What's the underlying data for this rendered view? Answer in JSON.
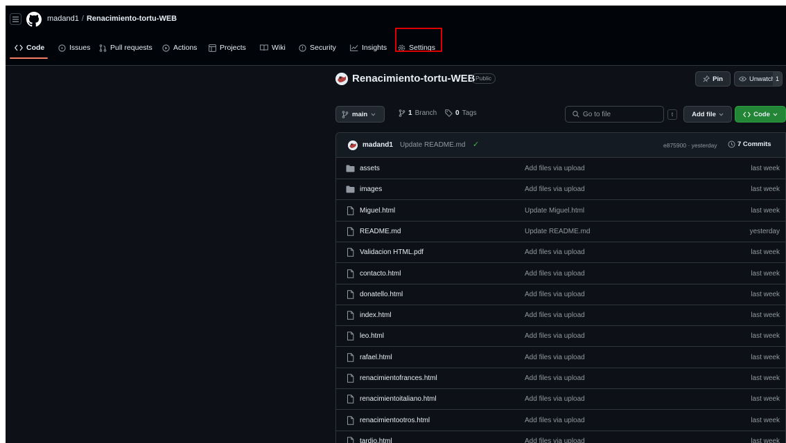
{
  "breadcrumb": {
    "owner": "madand1",
    "separator": "/",
    "repo": "Renacimiento-tortu-WEB"
  },
  "nav": {
    "tabs": [
      {
        "label": "Code",
        "icon": "code-icon"
      },
      {
        "label": "Issues",
        "icon": "issue-icon"
      },
      {
        "label": "Pull requests",
        "icon": "pull-request-icon"
      },
      {
        "label": "Actions",
        "icon": "play-icon"
      },
      {
        "label": "Projects",
        "icon": "table-icon"
      },
      {
        "label": "Wiki",
        "icon": "book-icon"
      },
      {
        "label": "Security",
        "icon": "shield-icon"
      },
      {
        "label": "Insights",
        "icon": "graph-icon"
      },
      {
        "label": "Settings",
        "icon": "gear-icon"
      }
    ]
  },
  "repo": {
    "name": "Renacimiento-tortu-WEB",
    "visibility": "Public",
    "pin_label": "Pin",
    "watch_label": "Unwatch",
    "watch_count": "1"
  },
  "branch_bar": {
    "branch": "main",
    "branch_count": "1",
    "branch_label": "Branch",
    "tag_count": "0",
    "tag_label": "Tags",
    "goto_placeholder": "Go to file",
    "goto_key": "t",
    "add_file": "Add file",
    "code": "Code"
  },
  "last_commit": {
    "author": "madand1",
    "message": "Update README.md",
    "hash_time": "e875900 · yesterday",
    "commits": "7 Commits"
  },
  "files": [
    {
      "type": "dir",
      "name": "assets",
      "message": "Add files via upload",
      "date": "last week"
    },
    {
      "type": "dir",
      "name": "images",
      "message": "Add files via upload",
      "date": "last week"
    },
    {
      "type": "file",
      "name": "Miguel.html",
      "message": "Update Miguel.html",
      "date": "last week"
    },
    {
      "type": "file",
      "name": "README.md",
      "message": "Update README.md",
      "date": "yesterday"
    },
    {
      "type": "file",
      "name": "Validacion HTML.pdf",
      "message": "Add files via upload",
      "date": "last week"
    },
    {
      "type": "file",
      "name": "contacto.html",
      "message": "Add files via upload",
      "date": "last week"
    },
    {
      "type": "file",
      "name": "donatello.html",
      "message": "Add files via upload",
      "date": "last week"
    },
    {
      "type": "file",
      "name": "index.html",
      "message": "Add files via upload",
      "date": "last week"
    },
    {
      "type": "file",
      "name": "leo.html",
      "message": "Add files via upload",
      "date": "last week"
    },
    {
      "type": "file",
      "name": "rafael.html",
      "message": "Add files via upload",
      "date": "last week"
    },
    {
      "type": "file",
      "name": "renacimientofrances.html",
      "message": "Add files via upload",
      "date": "last week"
    },
    {
      "type": "file",
      "name": "renacimientoitaliano.html",
      "message": "Add files via upload",
      "date": "last week"
    },
    {
      "type": "file",
      "name": "renacimientootros.html",
      "message": "Add files via upload",
      "date": "last week"
    },
    {
      "type": "file",
      "name": "tardio.html",
      "message": "Add files via upload",
      "date": "last week"
    }
  ],
  "colors": {
    "background": "#0d1117",
    "header": "#010409",
    "accent_underline": "#f78166",
    "code_button": "#238636",
    "highlight_box": "#e00000",
    "folder": "#9198a1"
  }
}
